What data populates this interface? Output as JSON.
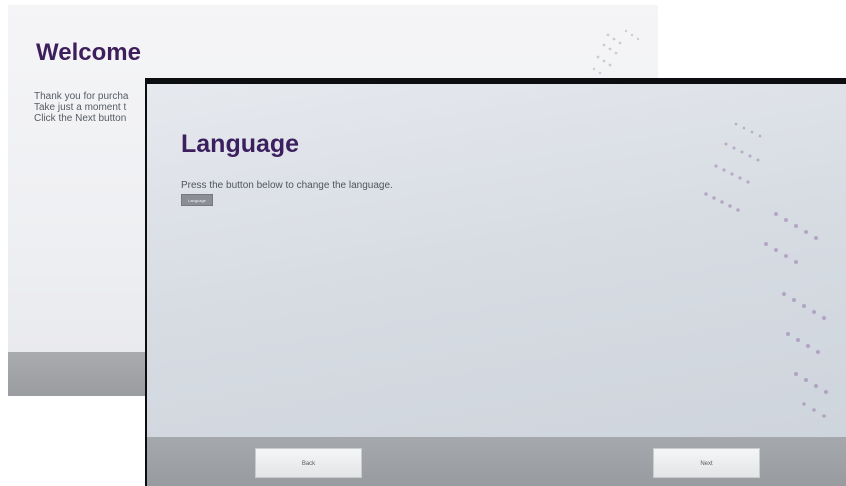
{
  "welcome_screen": {
    "title": "Welcome",
    "lines": [
      "Thank you for purcha",
      "Take just a moment t",
      "Click the Next button"
    ]
  },
  "language_screen": {
    "title": "Language",
    "subtitle": "Press the button below to change the language.",
    "language_button_label": "Language",
    "back_label": "Back",
    "next_label": "Next"
  },
  "colors": {
    "title_purple": "#3b1f5e",
    "footer_gray": "#9a9c9f",
    "decoration_purple": "#8a6aa0"
  },
  "icons": {
    "decoration": "dot-wave-pattern"
  }
}
